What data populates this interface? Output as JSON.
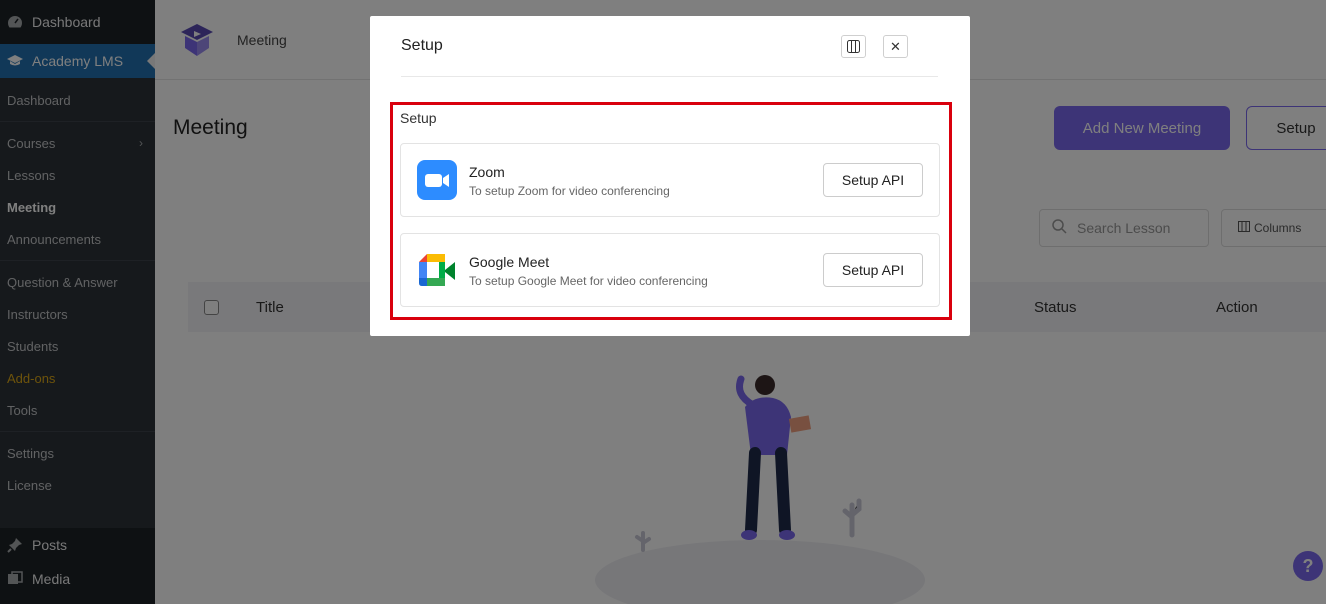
{
  "sidebar": {
    "top_label": "Dashboard",
    "active_label": "Academy LMS",
    "submenu": {
      "dashboard": "Dashboard",
      "courses": "Courses",
      "lessons": "Lessons",
      "meeting": "Meeting",
      "announcements": "Announcements",
      "qa": "Question & Answer",
      "instructors": "Instructors",
      "students": "Students",
      "addons": "Add-ons",
      "tools": "Tools",
      "settings": "Settings",
      "license": "License"
    },
    "posts_label": "Posts",
    "media_label": "Media"
  },
  "topbar": {
    "title": "Meeting"
  },
  "page": {
    "heading": "Meeting",
    "add_button": "Add New Meeting",
    "setup_button": "Setup",
    "search_placeholder": "Search Lesson",
    "columns_label": "Columns"
  },
  "table": {
    "columns": {
      "title": "Title",
      "status": "Status",
      "action": "Action"
    }
  },
  "help_label": "?",
  "modal": {
    "title": "Setup",
    "section_label": "Setup",
    "providers": [
      {
        "name": "Zoom",
        "description": "To setup Zoom for video conferencing",
        "button": "Setup API"
      },
      {
        "name": "Google Meet",
        "description": "To setup Google Meet for video conferencing",
        "button": "Setup API"
      }
    ]
  },
  "colors": {
    "accent": "#7b68ee",
    "highlight": "#d9000d",
    "wp_blue": "#2271b1"
  }
}
